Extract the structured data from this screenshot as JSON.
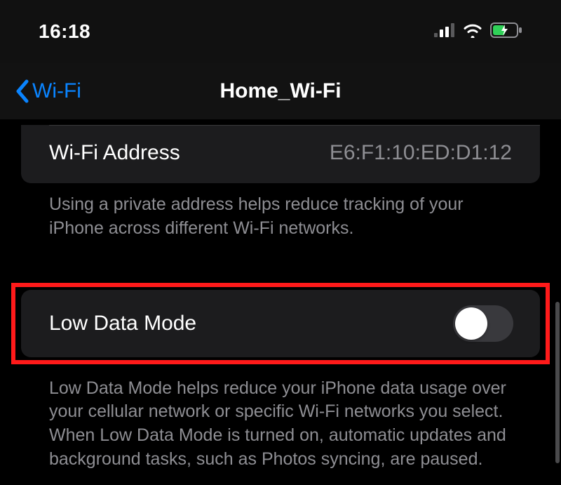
{
  "status": {
    "time": "16:18"
  },
  "nav": {
    "back_label": "Wi-Fi",
    "title": "Home_Wi-Fi"
  },
  "wifi_address": {
    "label": "Wi-Fi Address",
    "value": "E6:F1:10:ED:D1:12",
    "description": "Using a private address helps reduce tracking of your iPhone across different Wi-Fi networks."
  },
  "low_data_mode": {
    "label": "Low Data Mode",
    "enabled": false,
    "description": "Low Data Mode helps reduce your iPhone data usage over your cellular network or specific Wi-Fi networks you select. When Low Data Mode is turned on, automatic updates and background tasks, such as Photos syncing, are paused."
  }
}
